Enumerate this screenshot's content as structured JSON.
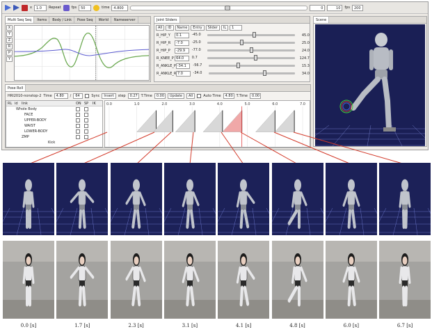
{
  "toolbar": {
    "speed_value": "1.0",
    "repeat_label": "Repeat",
    "fps_label": "fps",
    "fps_value": "50",
    "time_label": "time",
    "time_value": "4.800",
    "start_value": "0",
    "end_value": "10",
    "fps2_label": "fps",
    "fps2_value": "200"
  },
  "graph_panel": {
    "tabs": [
      "Multi Seq Seq",
      "Items",
      "Body / Link",
      "Pose Seq",
      "World",
      "Nameserver"
    ],
    "vbuttons": [
      "X",
      "Y",
      "Z",
      "R",
      "P",
      "Y"
    ]
  },
  "joint_panel": {
    "title": "Joint Sliders",
    "buttons": [
      "All",
      "ID",
      "Name",
      "Entry",
      "Slider",
      "IL"
    ],
    "il_value": "1",
    "joints": [
      {
        "name": "R_HIP_Y",
        "value": "0.1",
        "min": "-45.0",
        "max": "45.0",
        "pos": 0.5
      },
      {
        "name": "R_HIP_R",
        "value": "-7.0",
        "min": "-25.0",
        "max": "25.0",
        "pos": 0.36
      },
      {
        "name": "R_HIP_P",
        "value": "-29.9",
        "min": "-77.0",
        "max": "24.0",
        "pos": 0.47
      },
      {
        "name": "R_KNEE_P",
        "value": "64.0",
        "min": "0.7",
        "max": "124.7",
        "pos": 0.51
      },
      {
        "name": "R_ANKLE_P",
        "value": "-34.1",
        "min": "-56.7",
        "max": "15.3",
        "pos": 0.31
      },
      {
        "name": "R_ANKLE_R",
        "value": "7.0",
        "min": "-34.0",
        "max": "34.0",
        "pos": 0.6
      }
    ]
  },
  "scene_panel": {
    "title": "Scene"
  },
  "pose_panel": {
    "title": "Pose Roll",
    "sequence_name": "HRI2010-nonstop-2",
    "time_label": "Time",
    "time_value": "4.80",
    "of_label": "/",
    "total_value": "64",
    "sync_label": "Sync",
    "insert_label": "Insert",
    "step_label": "step",
    "step_value": "0.27",
    "ttime_label": "T.Time",
    "ttime_value": "0.00",
    "update_label": "Update",
    "all_label": "All",
    "autotime_label": "Auto Time",
    "autotime_value": "4.80",
    "ttime2_label": "T.Time",
    "ttime2_value": "0.00",
    "tree_headers": [
      "RL",
      "id",
      "link",
      "ON",
      "SP",
      "IK"
    ],
    "tree_rows": [
      "Whole Body",
      "FACE",
      "UPPER-BODY",
      "WAIST",
      "LOWER-BODY",
      "ZMP"
    ],
    "kick_label": "Kick",
    "timeline_ticks": [
      "0.0",
      "1.0",
      "2.0",
      "3.0",
      "4.0",
      "5.0",
      "6.0",
      "7.0"
    ]
  },
  "captions": [
    "0.0 [s]",
    "1.7 [s]",
    "2.3 [s]",
    "3.1 [s]",
    "4.1 [s]",
    "4.8 [s]",
    "6.0 [s]",
    "6.7 [s]"
  ],
  "colors": {
    "scene_bg": "#1a1f55",
    "connector": "#d33a2a",
    "curve_green": "#6aa84f",
    "curve_blue": "#5a5ad0"
  }
}
